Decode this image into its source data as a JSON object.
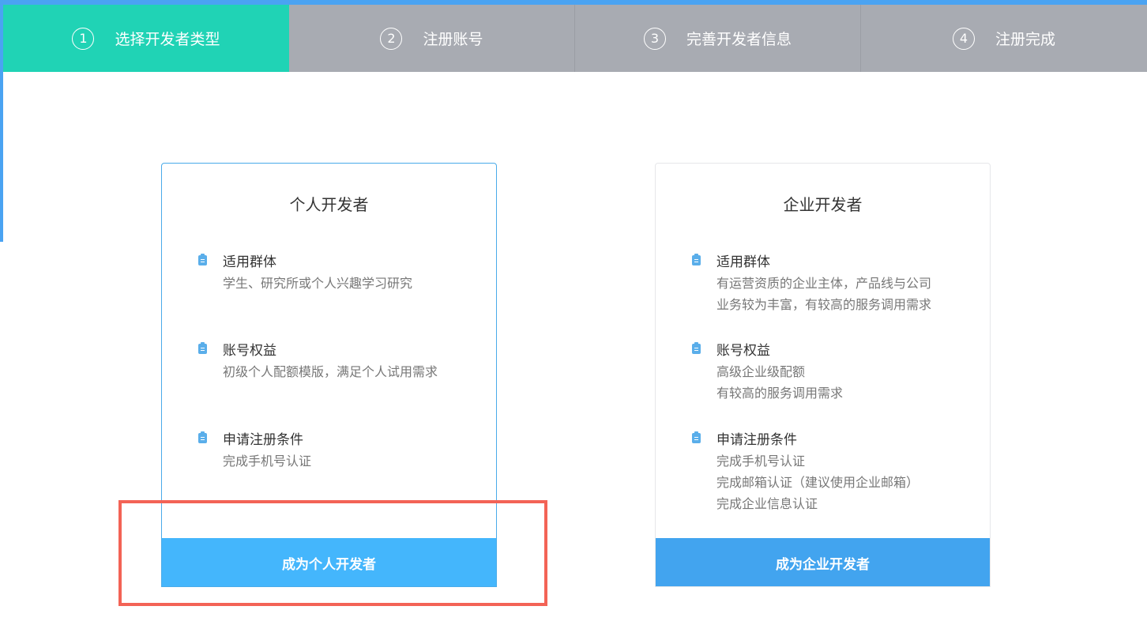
{
  "steps": [
    {
      "num": "1",
      "label": "选择开发者类型",
      "active": true
    },
    {
      "num": "2",
      "label": "注册账号",
      "active": false
    },
    {
      "num": "3",
      "label": "完善开发者信息",
      "active": false
    },
    {
      "num": "4",
      "label": "注册完成",
      "active": false
    }
  ],
  "personal": {
    "title": "个人开发者",
    "features": [
      {
        "icon": "document-icon",
        "title": "适用群体",
        "lines": [
          "学生、研究所或个人兴趣学习研究"
        ]
      },
      {
        "icon": "document-icon",
        "title": "账号权益",
        "lines": [
          "初级个人配额模版，满足个人试用需求"
        ]
      },
      {
        "icon": "document-icon",
        "title": "申请注册条件",
        "lines": [
          "完成手机号认证"
        ]
      }
    ],
    "button_label": "成为个人开发者"
  },
  "enterprise": {
    "title": "企业开发者",
    "features": [
      {
        "icon": "document-icon",
        "title": "适用群体",
        "lines": [
          "有运营资质的企业主体，产品线与公司",
          "业务较为丰富，有较高的服务调用需求"
        ]
      },
      {
        "icon": "document-icon",
        "title": "账号权益",
        "lines": [
          "高级企业级配额",
          "有较高的服务调用需求"
        ]
      },
      {
        "icon": "document-icon",
        "title": "申请注册条件",
        "lines": [
          "完成手机号认证",
          "完成邮箱认证（建议使用企业邮箱）",
          "完成企业信息认证"
        ]
      }
    ],
    "button_label": "成为企业开发者"
  },
  "colors": {
    "active_step": "#20d3b5",
    "inactive_step": "#a8abb2",
    "personal_button": "#44b6fc",
    "enterprise_button": "#42a4ef",
    "highlight_box": "#f36356",
    "accent": "#4aa3f2"
  }
}
